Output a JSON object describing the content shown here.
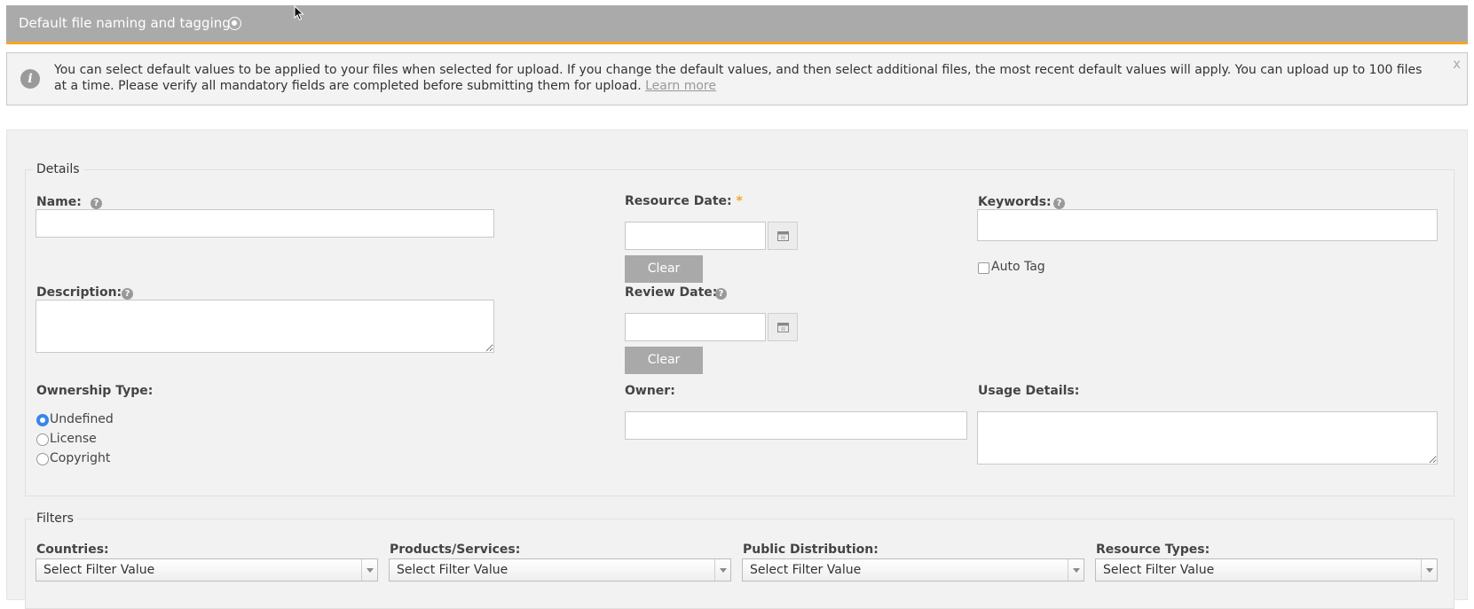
{
  "header": {
    "title": "Default file naming and tagging",
    "toggle_icon": "circle-dot-icon",
    "bg_color": "#aaaaaa",
    "accent_color": "#f5a623"
  },
  "info": {
    "icon": "info-icon",
    "icon_glyph": "i",
    "text": "You can select default values to be applied to your files when selected for upload. If you change the default values, and then select additional files, the most recent default values will apply. You can upload up to 100 files at a time. Please verify all mandatory fields are completed before submitting them for upload.",
    "link_text": "Learn more",
    "close_glyph": "x"
  },
  "details": {
    "legend": "Details",
    "name": {
      "label": "Name:",
      "value": ""
    },
    "description": {
      "label": "Description:",
      "value": ""
    },
    "resource_date": {
      "label": "Resource Date:",
      "required_mark": "*",
      "value": "",
      "clear_label": "Clear"
    },
    "review_date": {
      "label": "Review Date:",
      "value": "",
      "clear_label": "Clear"
    },
    "keywords": {
      "label": "Keywords:",
      "value": "",
      "auto_tag_label": "Auto Tag",
      "auto_tag_checked": false
    },
    "ownership": {
      "label": "Ownership Type:",
      "options": [
        "Undefined",
        "License",
        "Copyright"
      ],
      "selected": "Undefined"
    },
    "owner": {
      "label": "Owner:",
      "value": ""
    },
    "usage": {
      "label": "Usage Details:",
      "value": ""
    },
    "help_glyph": "?"
  },
  "filters": {
    "legend": "Filters",
    "items": [
      {
        "label": "Countries:",
        "value": "Select Filter Value"
      },
      {
        "label": "Products/Services:",
        "value": "Select Filter Value"
      },
      {
        "label": "Public Distribution:",
        "value": "Select Filter Value"
      },
      {
        "label": "Resource Types:",
        "value": "Select Filter Value"
      }
    ]
  }
}
